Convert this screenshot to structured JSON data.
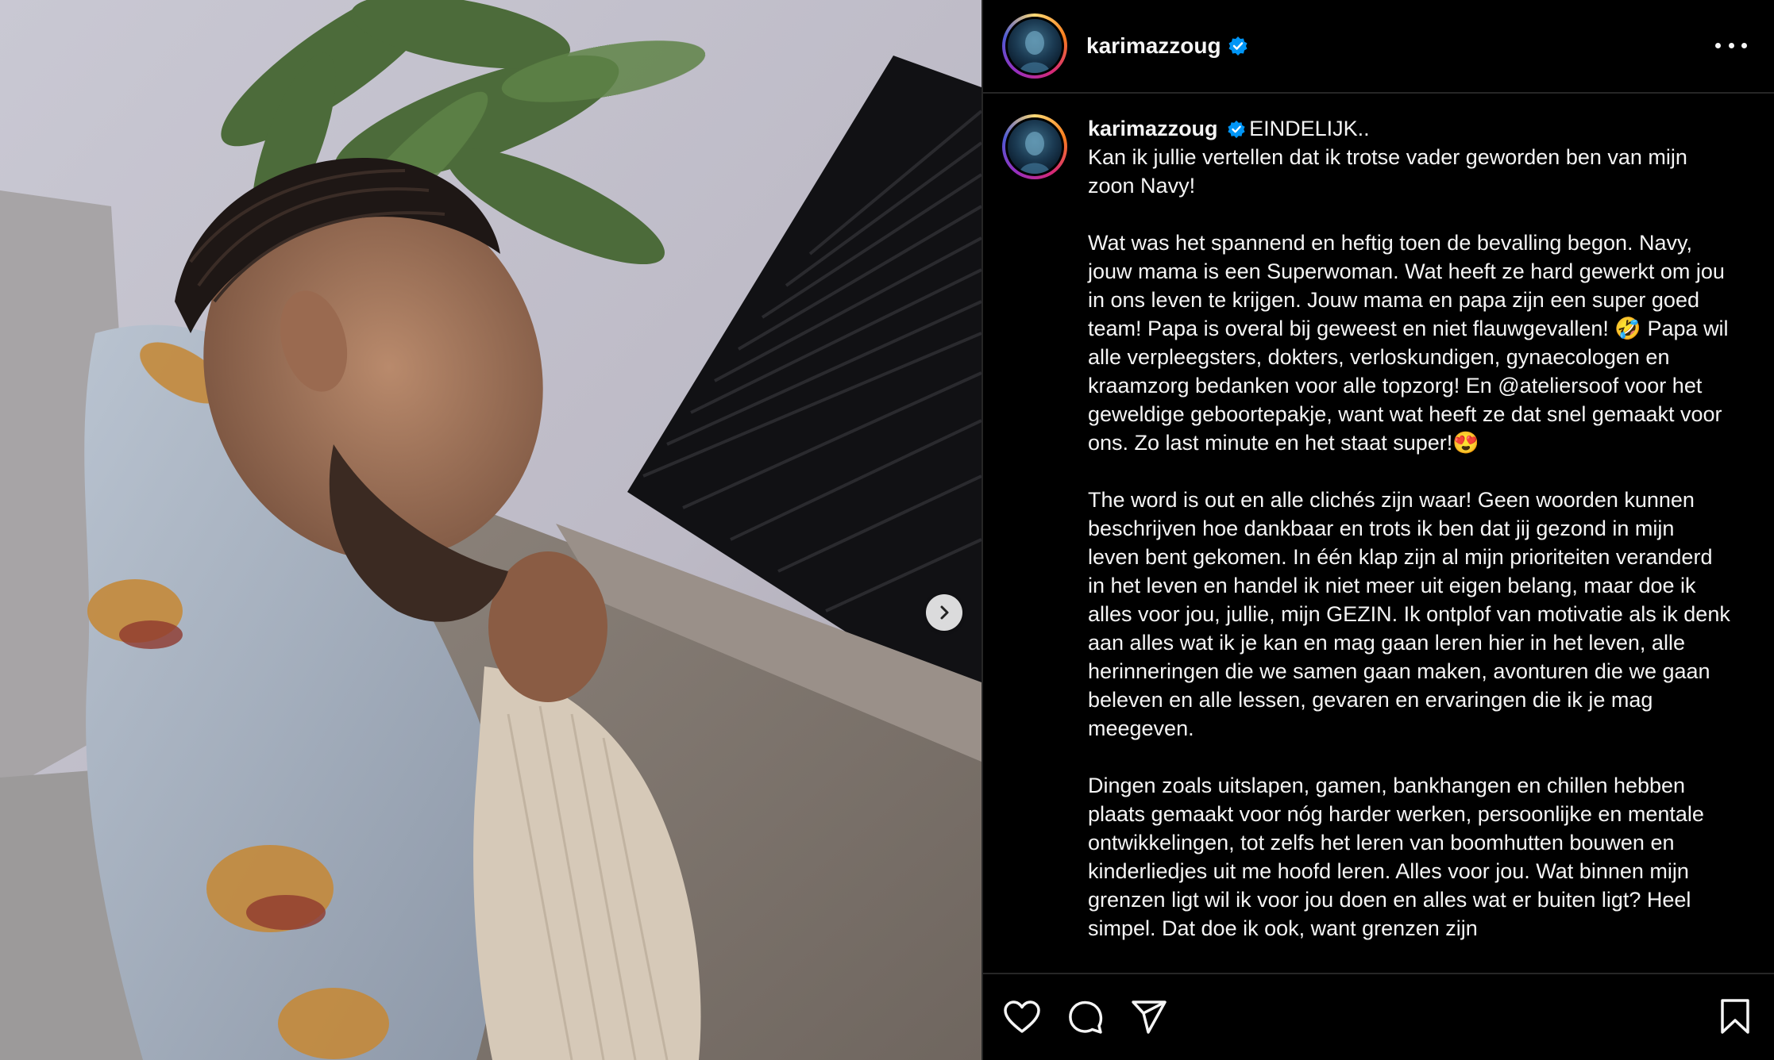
{
  "post": {
    "username": "karimazzoug",
    "verified": true,
    "caption_first_word": "EINDELIJK..",
    "caption_body": "Kan ik jullie vertellen dat ik trotse vader geworden ben van mijn zoon Navy!\n\nWat was het spannend en heftig toen de bevalling begon. Navy, jouw mama is een Superwoman. Wat heeft ze hard gewerkt om jou in ons leven te krijgen. Jouw mama en papa zijn een super goed team! Papa is overal bij geweest en niet flauwgevallen! 🤣 Papa wil alle verpleegsters, dokters, verloskundigen, gynaecologen en kraamzorg bedanken voor alle topzorg! En @ateliersoof voor het geweldige geboortepakje, want wat heeft ze dat snel gemaakt voor ons. Zo last minute en het staat super!😍\n\nThe word is out en alle clichés zijn waar! Geen woorden kunnen beschrijven hoe dankbaar en trots ik ben dat jij gezond in mijn leven bent gekomen. In één klap zijn al mijn prioriteiten veranderd in het leven en handel ik niet meer uit eigen belang, maar doe ik alles voor jou, jullie, mijn GEZIN. Ik ontplof van motivatie als ik denk aan alles wat ik je kan en mag gaan leren hier in het leven, alle herinneringen die we samen gaan maken, avonturen die we gaan beleven en alle lessen, gevaren en ervaringen die ik je mag meegeven.\n\nDingen zoals uitslapen, gamen, bankhangen en chillen hebben plaats gemaakt voor nóg harder werken, persoonlijke en mentale ontwikkelingen, tot zelfs het leren van boomhutten bouwen en kinderliedjes uit me hoofd leren. Alles voor jou. Wat binnen mijn grenzen ligt wil ik voor jou doen en alles wat er buiten ligt? Heel simpel. Dat doe ik ook, want grenzen zijn"
  },
  "icons": {
    "more": "more-icon",
    "like": "heart-icon",
    "comment": "comment-icon",
    "share": "share-icon",
    "save": "bookmark-icon",
    "next": "chevron-right-icon",
    "verified": "verified-badge-icon"
  },
  "colors": {
    "background": "#000000",
    "text": "#f5f5f5",
    "verified": "#0095f6",
    "divider": "#262626"
  }
}
